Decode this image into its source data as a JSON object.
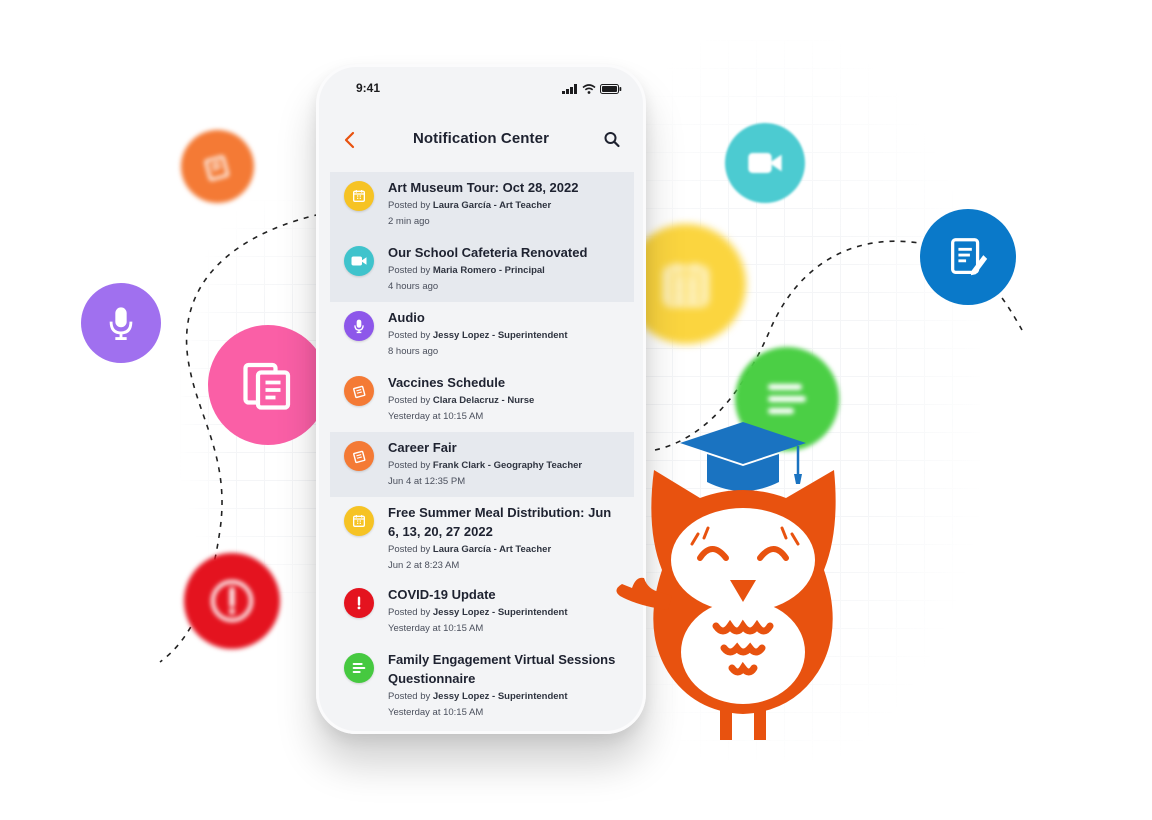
{
  "status": {
    "time": "9:41"
  },
  "header": {
    "title": "Notification Center"
  },
  "posted_prefix": "Posted by ",
  "notifications": [
    {
      "title": "Art Museum Tour: Oct 28, 2022",
      "author": "Laura García - Art Teacher",
      "time": "2 min ago",
      "icon": "calendar-icon",
      "color": "#f6c324",
      "highlighted": true
    },
    {
      "title": "Our School Cafeteria Renovated",
      "author": "Maria Romero - Principal",
      "time": "4 hours ago",
      "icon": "video-icon",
      "color": "#3fc3cc",
      "highlighted": true
    },
    {
      "title": "Audio",
      "author": "Jessy Lopez - Superintendent",
      "time": "8 hours ago",
      "icon": "microphone-icon",
      "color": "#8d57ea",
      "highlighted": false
    },
    {
      "title": "Vaccines Schedule",
      "author": "Clara Delacruz - Nurse",
      "time": "Yesterday at 10:15 AM",
      "icon": "notes-icon",
      "color": "#f47a35",
      "highlighted": false
    },
    {
      "title": "Career Fair",
      "author": "Frank Clark - Geography Teacher",
      "time": "Jun 4 at 12:35 PM",
      "icon": "notes-icon",
      "color": "#f47a35",
      "highlighted": true
    },
    {
      "title": "Free Summer Meal Distribution: Jun 6, 13, 20, 27 2022",
      "author": "Laura García - Art Teacher",
      "time": "Jun 2 at 8:23 AM",
      "icon": "calendar-icon",
      "color": "#f6c324",
      "highlighted": false
    },
    {
      "title": "COVID-19 Update",
      "author": "Jessy Lopez - Superintendent",
      "time": "Yesterday at 10:15 AM",
      "icon": "alert-icon",
      "color": "#e4131f",
      "highlighted": false
    },
    {
      "title": "Family Engagement Virtual Sessions Questionnaire",
      "author": "Jessy Lopez - Superintendent",
      "time": "Yesterday at 10:15 AM",
      "icon": "form-icon",
      "color": "#46c940",
      "highlighted": false
    }
  ],
  "colors": {
    "accent": "#e8520f",
    "owl": "#e8520f",
    "cap": "#1a73c1"
  },
  "floating_icons": [
    {
      "icon": "notes-icon",
      "color": "#f47a35"
    },
    {
      "icon": "microphone-icon",
      "color": "#a070ef"
    },
    {
      "icon": "documents-icon",
      "color": "#fa5fa6"
    },
    {
      "icon": "alert-icon",
      "color": "#e4131f"
    },
    {
      "icon": "video-icon",
      "color": "#4ccbd1"
    },
    {
      "icon": "calendar-icon",
      "color": "#fbd53f"
    },
    {
      "icon": "form-icon",
      "color": "#4bcf45"
    },
    {
      "icon": "edit-document-icon",
      "color": "#0a79c9"
    }
  ]
}
